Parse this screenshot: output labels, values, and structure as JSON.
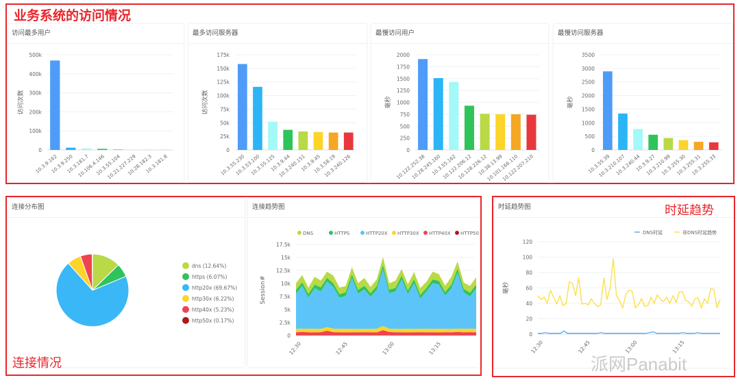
{
  "annotations": {
    "top": "业务系统的访问情况",
    "connection": "连接情况",
    "latency": "时延趋势"
  },
  "watermark": "派网Panabit",
  "colors": {
    "bars": [
      "#4e9cf7",
      "#2bb5f7",
      "#a3f8f8",
      "#2ec45b",
      "#b9d946",
      "#fcd42a",
      "#f5a623",
      "#e8383d"
    ],
    "dns": "#b9d946",
    "https": "#2ec45b",
    "http20x": "#3ab7f7",
    "http30x": "#fcd42a",
    "http40x": "#ee4450",
    "http50x": "#b01818",
    "dns_latency": "#5aaef5",
    "nondns_latency": "#fbe04a"
  },
  "chart_data": [
    {
      "id": "top-users",
      "type": "bar",
      "title": "访问最多用户",
      "ylabel": "访问次数",
      "ylim": [
        0,
        500000
      ],
      "yticks": [
        "0",
        "100k",
        "200k",
        "300k",
        "400k",
        "500k"
      ],
      "categories": [
        "10.3.9.162",
        "10.3.9.250",
        "10.3.181.7",
        "10.106.4.146",
        "10.3.55.104",
        "10.21.227.229",
        "10.28.182.3",
        "10.3.181.8"
      ],
      "values": [
        470000,
        12000,
        8000,
        6000,
        4000,
        1000,
        500,
        300
      ]
    },
    {
      "id": "top-servers",
      "type": "bar",
      "title": "最多访问服务器",
      "ylabel": "访问次数",
      "ylim": [
        0,
        175000
      ],
      "yticks": [
        "0",
        "25k",
        "50k",
        "75k",
        "100k",
        "125k",
        "150k",
        "175k"
      ],
      "categories": [
        "10.3.55.230",
        "10.3.53.100",
        "10.3.55.125",
        "10.3.9.44",
        "10.3.240.151",
        "10.3.9.45",
        "10.3.58.19",
        "10.3.240.126"
      ],
      "values": [
        158000,
        116000,
        52000,
        37000,
        34000,
        33000,
        32000,
        32000
      ]
    },
    {
      "id": "slow-users",
      "type": "bar",
      "title": "最慢访问用户",
      "ylabel": "毫秒",
      "ylim": [
        0,
        2000
      ],
      "yticks": [
        "0",
        "250",
        "500",
        "750",
        "1000",
        "1250",
        "1500",
        "1750",
        "2000"
      ],
      "categories": [
        "10.122.252.38",
        "10.28.245.160",
        "10.3.55.162",
        "10.122.206.12",
        "10.128.226.12",
        "10.38.13.99",
        "10.101.166.110",
        "10.122.207.210"
      ],
      "values": [
        1910,
        1510,
        1430,
        930,
        760,
        750,
        750,
        740
      ]
    },
    {
      "id": "slow-servers",
      "type": "bar",
      "title": "最慢访问服务器",
      "ylabel": "毫秒",
      "ylim": [
        0,
        3500
      ],
      "yticks": [
        "0",
        "500",
        "1000",
        "1500",
        "2000",
        "2500",
        "3000",
        "3500"
      ],
      "categories": [
        "10.3.55.39",
        "10.3.210.107",
        "10.3.240.44",
        "10.3.9.27",
        "10.3.210.99",
        "10.3.255.30",
        "10.3.255.31",
        "10.3.255.33"
      ],
      "values": [
        2890,
        1340,
        770,
        560,
        440,
        360,
        300,
        280
      ]
    },
    {
      "id": "conn-dist",
      "type": "pie",
      "title": "连接分布图",
      "slices": [
        {
          "label": "dns (12.64%)",
          "value": 12.64
        },
        {
          "label": "https (6.07%)",
          "value": 6.07
        },
        {
          "label": "http20x (69.67%)",
          "value": 69.67
        },
        {
          "label": "http30x (6.22%)",
          "value": 6.22
        },
        {
          "label": "http40x (5.23%)",
          "value": 5.23
        },
        {
          "label": "http50x (0.17%)",
          "value": 0.17
        }
      ]
    },
    {
      "id": "conn-trend",
      "type": "area",
      "title": "连接趋势图",
      "ylabel": "Session#",
      "ylim": [
        0,
        17500
      ],
      "yticks": [
        "0",
        "2.5k",
        "5k",
        "7.5k",
        "10k",
        "12.5k",
        "15k",
        "17.5k"
      ],
      "xticks": [
        "12:30",
        "12:45",
        "13:00",
        "13:15"
      ],
      "xtick_minutes": [
        1,
        16,
        31,
        46
      ],
      "x_minutes_range": [
        0,
        58
      ],
      "x_step_minutes": 2,
      "legend": [
        "DNS",
        "HTTPS",
        "HTTP20X",
        "HTTP30X",
        "HTTP40X",
        "HTTP50X"
      ],
      "series": [
        {
          "name": "HTTP50X",
          "values": [
            20,
            20,
            20,
            20,
            20,
            20,
            20,
            20,
            20,
            20,
            20,
            20,
            20,
            20,
            20,
            20,
            20,
            20,
            20,
            20,
            20,
            20,
            20,
            20,
            20,
            20,
            20,
            20,
            20,
            20
          ]
        },
        {
          "name": "HTTP40X",
          "values": [
            600,
            650,
            600,
            580,
            620,
            900,
            620,
            600,
            580,
            600,
            600,
            620,
            600,
            580,
            1000,
            650,
            600,
            600,
            580,
            600,
            620,
            600,
            600,
            580,
            620,
            600,
            650,
            600,
            620,
            600
          ]
        },
        {
          "name": "HTTP30X",
          "values": [
            650,
            650,
            700,
            680,
            650,
            700,
            680,
            650,
            700,
            650,
            650,
            620,
            650,
            700,
            800,
            650,
            660,
            650,
            700,
            650,
            650,
            680,
            650,
            700,
            650,
            650,
            650,
            680,
            700,
            650
          ]
        },
        {
          "name": "HTTP20X",
          "values": [
            6800,
            8200,
            6000,
            7800,
            7200,
            8800,
            8000,
            6000,
            6300,
            9800,
            6800,
            7600,
            6200,
            7500,
            11000,
            6800,
            7200,
            9500,
            6700,
            8800,
            5800,
            7200,
            8800,
            8500,
            6400,
            7800,
            10800,
            7000,
            6200,
            7800
          ]
        },
        {
          "name": "HTTPS",
          "values": [
            700,
            700,
            650,
            700,
            750,
            650,
            700,
            650,
            700,
            650,
            700,
            700,
            650,
            700,
            750,
            700,
            650,
            700,
            650,
            700,
            700,
            650,
            700,
            700,
            650,
            700,
            700,
            650,
            700,
            700
          ]
        },
        {
          "name": "DNS",
          "values": [
            1300,
            1400,
            1200,
            1500,
            1300,
            1200,
            1500,
            1300,
            1200,
            1400,
            1300,
            1500,
            1200,
            1300,
            1500,
            1200,
            1400,
            1300,
            1200,
            1400,
            1300,
            1200,
            1500,
            1300,
            1200,
            1500,
            1400,
            1200,
            1300,
            1400
          ]
        }
      ]
    },
    {
      "id": "latency-trend",
      "type": "line",
      "title": "时延趋势图",
      "ylabel": "毫秒",
      "ylim": [
        0,
        120
      ],
      "yticks": [
        "0",
        "20",
        "40",
        "60",
        "80",
        "100",
        "120"
      ],
      "xticks": [
        "12:30",
        "12:45",
        "13:00",
        "13:15"
      ],
      "xtick_minutes": [
        1,
        16,
        31,
        46
      ],
      "x_minutes_range": [
        0,
        58
      ],
      "x_step_minutes": 1.5,
      "legend": [
        "DNS时延",
        "非DNS时延趋势"
      ],
      "series": [
        {
          "name": "DNS时延",
          "values": [
            1,
            1,
            2,
            1,
            1,
            1,
            1,
            4,
            1,
            1,
            1,
            1,
            1,
            1,
            1,
            1,
            1,
            2,
            1,
            1,
            1,
            1,
            1,
            1,
            1,
            1,
            1,
            1,
            1,
            1,
            2,
            3,
            1,
            1,
            1,
            1,
            1,
            1,
            1,
            2,
            1,
            1,
            1,
            2,
            1,
            1,
            1,
            1,
            1,
            1
          ]
        },
        {
          "name": "非DNS时延趋势",
          "values": [
            50,
            45,
            48,
            40,
            57,
            48,
            39,
            50,
            37,
            40,
            68,
            66,
            50,
            73,
            39,
            40,
            38,
            46,
            40,
            36,
            38,
            73,
            45,
            60,
            98,
            50,
            43,
            34,
            52,
            57,
            56,
            34,
            38,
            46,
            36,
            37,
            48,
            40,
            51,
            45,
            42,
            48,
            40,
            50,
            41,
            55,
            55,
            44,
            42,
            36,
            46,
            47,
            34,
            46,
            40,
            59,
            58,
            34,
            45
          ]
        }
      ]
    }
  ]
}
